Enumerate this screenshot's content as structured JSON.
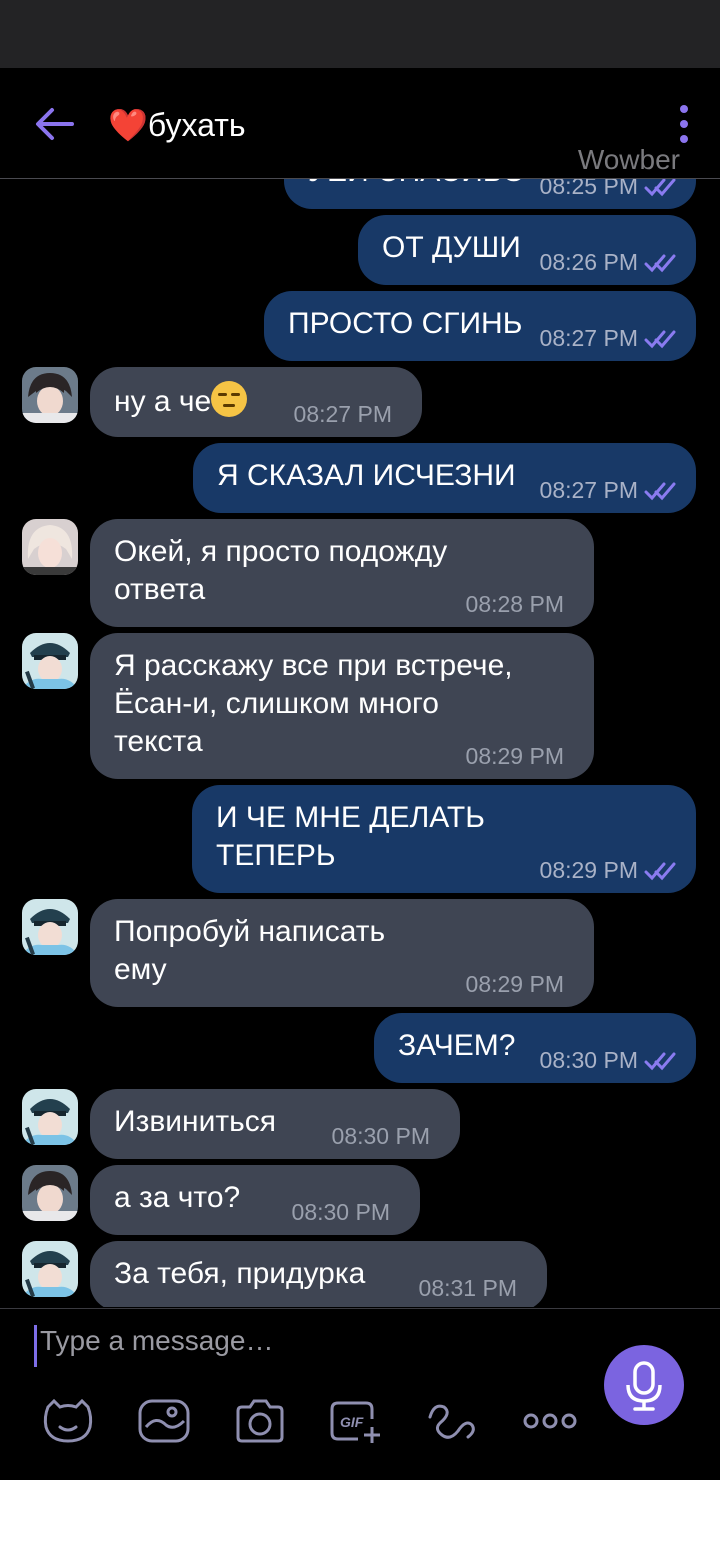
{
  "header": {
    "title": "бухать",
    "heart": "❤️",
    "watermark": "Wowber"
  },
  "messages": [
    {
      "dir": "out",
      "text": "УЕЙ СПАСИБО",
      "time": "08:25 PM",
      "partial": true
    },
    {
      "dir": "out",
      "text": "ОТ ДУШИ",
      "time": "08:26 PM"
    },
    {
      "dir": "out",
      "text": "ПРОСТО СГИНЬ",
      "time": "08:27 PM"
    },
    {
      "dir": "in",
      "text": "ну а че",
      "emoji": "unamused-face",
      "time": "08:27 PM",
      "avatar": "avatar-dark-hair"
    },
    {
      "dir": "out",
      "text": "Я СКАЗАЛ ИСЧЕЗНИ",
      "time": "08:27 PM"
    },
    {
      "dir": "in",
      "text": "Окей, я просто подожду\nответа",
      "time": "08:28 PM",
      "avatar": "avatar-blonde"
    },
    {
      "dir": "in",
      "text": "Я расскажу все при встрече,\nЁсан-и, слишком много\nтекста",
      "time": "08:29 PM",
      "avatar": "avatar-police-cap"
    },
    {
      "dir": "out",
      "text": "И ЧЕ МНЕ ДЕЛАТЬ\nТЕПЕРЬ",
      "time": "08:29 PM"
    },
    {
      "dir": "in",
      "text": "Попробуй написать\nему",
      "time": "08:29 PM",
      "avatar": "avatar-police-cap"
    },
    {
      "dir": "out",
      "text": "ЗАЧЕМ?",
      "time": "08:30 PM"
    },
    {
      "dir": "in",
      "text": "Извиниться",
      "time": "08:30 PM",
      "avatar": "avatar-police-cap"
    },
    {
      "dir": "in",
      "text": "а за что?",
      "time": "08:30 PM",
      "avatar": "avatar-dark-hair"
    },
    {
      "dir": "in",
      "text": "За тебя, придурка",
      "time": "08:31 PM",
      "avatar": "avatar-police-cap"
    }
  ],
  "composer": {
    "placeholder": "Type a message…",
    "tools": [
      "sticker-icon",
      "gallery-icon",
      "camera-icon",
      "gif-icon",
      "doodle-icon",
      "more-icon"
    ]
  },
  "colors": {
    "outgoing_bubble": "#183967",
    "incoming_bubble": "#3f4553",
    "accent": "#7b64e0"
  }
}
